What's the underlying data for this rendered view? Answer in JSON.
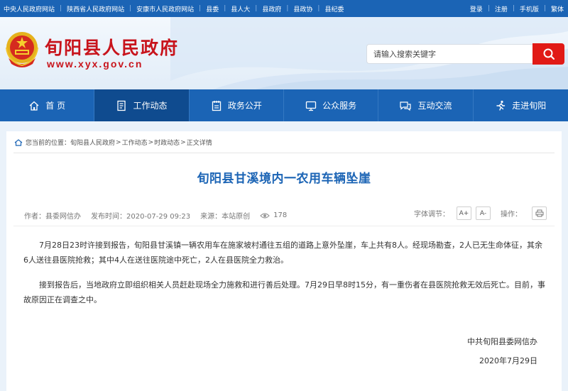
{
  "topbar": {
    "left_links": [
      "中央人民政府网站",
      "陕西省人民政府网站",
      "安康市人民政府网站",
      "县委",
      "县人大",
      "县政府",
      "县政协",
      "县纪委"
    ],
    "right_links": [
      "登录",
      "注册",
      "手机版",
      "繁体"
    ]
  },
  "header": {
    "site_title": "旬阳县人民政府",
    "site_url": "www.xyx.gov.cn",
    "search_placeholder": "请输入搜索关键字"
  },
  "nav": {
    "items": [
      {
        "label": "首 页",
        "icon": "home-icon"
      },
      {
        "label": "工作动态",
        "icon": "document-icon"
      },
      {
        "label": "政务公开",
        "icon": "notepad-icon"
      },
      {
        "label": "公众服务",
        "icon": "monitor-icon"
      },
      {
        "label": "互动交流",
        "icon": "chat-icon"
      },
      {
        "label": "走进旬阳",
        "icon": "running-person-icon"
      }
    ],
    "active_index": 1
  },
  "breadcrumb": {
    "prefix": "您当前的位置：",
    "items": [
      "旬阳县人民政府",
      "工作动态",
      "时政动态",
      "正文详情"
    ],
    "separator": ">"
  },
  "article": {
    "title": "旬阳县甘溪境内一农用车辆坠崖",
    "author": "作者：县委网信办",
    "published": "发布时间：2020-07-29 09:23",
    "source": "来源：本站原创",
    "views": "178",
    "font_size_label": "字体调节：",
    "font_increase": "A+",
    "font_decrease": "A-",
    "actions_label": "操作：",
    "paragraphs": [
      "7月28日23时许接到报告，旬阳县甘溪镇一辆农用车在施家坡村通往五组的道路上意外坠崖，车上共有8人。经现场勘查，2人已无生命体征，其余6人送往县医院抢救；其中4人在送往医院途中死亡，2人在县医院全力救治。",
      "接到报告后，当地政府立即组织相关人员赶赴现场全力施救和进行善后处理。7月29日早8时15分，有一重伤者在县医院抢救无效后死亡。目前，事故原因正在调查之中。"
    ],
    "signature_org": "中共旬阳县委网信办",
    "signature_date": "2020年7月29日"
  },
  "colors": {
    "nav_blue": "#1b64b5",
    "nav_active": "#0f4b8f",
    "title_red": "#c8141c",
    "search_red": "#e11a16"
  }
}
